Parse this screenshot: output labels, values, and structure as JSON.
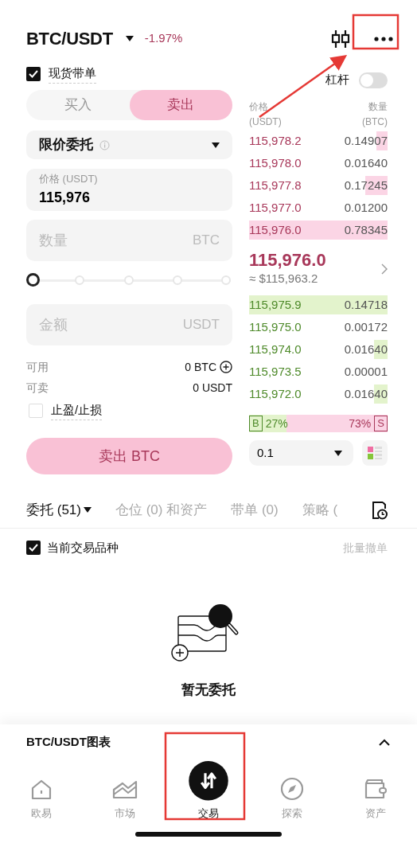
{
  "header": {
    "pair": "BTC/USDT",
    "change": "-1.97%"
  },
  "copy_trade": {
    "label": "现货带单",
    "checked": true
  },
  "leverage": {
    "label": "杠杆",
    "on": false
  },
  "sides": [
    {
      "label": "买入",
      "selected": false
    },
    {
      "label": "卖出",
      "selected": true
    }
  ],
  "order_type": "限价委托",
  "price_field": {
    "label": "价格 (USDT)",
    "value": "115,976"
  },
  "qty_field": {
    "placeholder": "数量",
    "unit": "BTC"
  },
  "slider": {
    "level": 0
  },
  "amount_field": {
    "placeholder": "金额",
    "unit": "USDT"
  },
  "balances": [
    {
      "label": "可用",
      "value": "0 BTC",
      "kind": "add"
    },
    {
      "label": "可卖",
      "value": "0 USDT",
      "kind": "plain"
    }
  ],
  "tp_sl": {
    "label": "止盈/止损",
    "checked": false
  },
  "submit": "卖出 BTC",
  "book": {
    "price_header": "价格",
    "price_unit": "(USDT)",
    "qty_header": "数量",
    "qty_unit": "(BTC)",
    "asks": [
      {
        "price": "115,978.2",
        "qty": "0.14907",
        "level": 0.08
      },
      {
        "price": "115,978.0",
        "qty": "0.01640"
      },
      {
        "price": "115,977.8",
        "qty": "0.17245",
        "level": 0.16
      },
      {
        "price": "115,977.0",
        "qty": "0.01200"
      },
      {
        "price": "115,976.0",
        "qty": "0.78345",
        "level": 1
      }
    ],
    "last_price": "115,976.0",
    "last_usd": "≈ $115,963.2",
    "bids": [
      {
        "price": "115,975.9",
        "qty": "0.14718",
        "level": 1
      },
      {
        "price": "115,975.0",
        "qty": "0.00172"
      },
      {
        "price": "115,974.0",
        "qty": "0.01640",
        "level": 0.1
      },
      {
        "price": "115,973.5",
        "qty": "0.00001"
      },
      {
        "price": "115,972.0",
        "qty": "0.01640",
        "level": 0.1
      }
    ],
    "ratio": {
      "buy_tag": "B",
      "buy": "27%",
      "sell": "73%",
      "sell_tag": "S",
      "level": 0.27
    },
    "precision": "0.1"
  },
  "order_tabs": [
    {
      "label": "委托 (51)",
      "selected": true,
      "dropdown": true
    },
    {
      "label": "仓位 (0) 和资产",
      "selected": false,
      "dropdown": false
    },
    {
      "label": "带单 (0)",
      "selected": false,
      "dropdown": false
    },
    {
      "label": "策略 (",
      "selected": false,
      "dropdown": false
    }
  ],
  "filter": {
    "label": "当前交易品种",
    "checked": true
  },
  "bulk_cancel": "批量撤单",
  "empty": "暂无委托",
  "chart_bar": "BTC/USDT图表",
  "nav": [
    {
      "label": "欧易",
      "kind": "home",
      "selected": false
    },
    {
      "label": "市场",
      "kind": "chart",
      "selected": false
    },
    {
      "label": "交易",
      "kind": "trade",
      "selected": true
    },
    {
      "label": "探索",
      "kind": "compass",
      "selected": false
    },
    {
      "label": "资产",
      "kind": "wallet",
      "selected": false
    }
  ],
  "highlights": {
    "more": true,
    "trade": true,
    "arrow": true
  }
}
